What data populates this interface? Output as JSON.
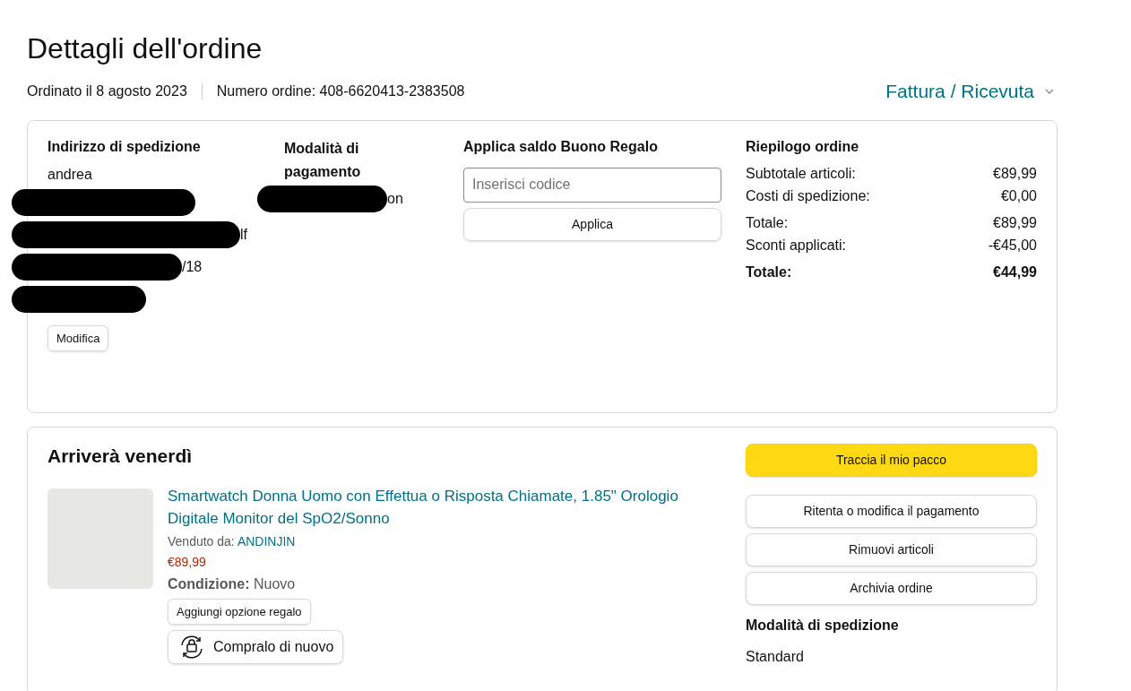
{
  "title": "Dettagli dell'ordine",
  "order_date": "Ordinato il 8 agosto 2023",
  "order_number": "Numero ordine: 408-6620413-2383508",
  "invoice_menu": "Fattura / Ricevuta",
  "shipping_address": {
    "heading": "Indirizzo di spedizione",
    "name": "andrea",
    "lines": [
      {
        "kind": "redacted"
      },
      {
        "kind": "partly_redacted",
        "visible_text": "lf"
      },
      {
        "kind": "partly_redacted",
        "visible_text": "/18"
      },
      {
        "kind": "redacted"
      }
    ],
    "edit_button": "Modifica"
  },
  "payment_method": {
    "heading": "Modalità di pagamento",
    "visible_text": "on"
  },
  "gift_card": {
    "heading": "Applica saldo Buono Regalo",
    "placeholder": "Inserisci codice",
    "button": "Applica"
  },
  "summary": {
    "heading": "Riepilogo ordine",
    "groups": [
      [
        {
          "label": "Subtotale articoli:",
          "value": "€89,99",
          "bold": false
        },
        {
          "label": "Costi di spedizione:",
          "value": "€0,00",
          "bold": false
        }
      ],
      [
        {
          "label": "Totale:",
          "value": "€89,99",
          "bold": false
        },
        {
          "label": "Sconti applicati:",
          "value": "-€45,00",
          "bold": false
        }
      ],
      [
        {
          "label": "Totale:",
          "value": "€44,99",
          "bold": true
        }
      ]
    ]
  },
  "shipment": {
    "heading": "Arriverà venerdì",
    "product": {
      "title": "Smartwatch Donna Uomo con Effettua o Risposta Chiamate, 1.85\" Orologio Digitale Monitor del SpO2/Sonno",
      "sold_by_label": "Venduto da:",
      "seller": "ANDINJIN",
      "price": "€89,99",
      "condition_label": "Condizione:",
      "condition": "Nuovo",
      "gift_button": "Aggiungi opzione regalo",
      "buy_again_button": "Compralo di nuovo"
    },
    "actions": [
      {
        "label": "Traccia il mio pacco",
        "kind": "primary"
      },
      {
        "label": "Ritenta o modifica il pagamento",
        "kind": "secondary"
      },
      {
        "label": "Rimuovi articoli",
        "kind": "secondary"
      },
      {
        "label": "Archivia ordine",
        "kind": "secondary"
      }
    ],
    "shipping_method_heading": "Modalità di spedizione",
    "shipping_method": "Standard"
  }
}
